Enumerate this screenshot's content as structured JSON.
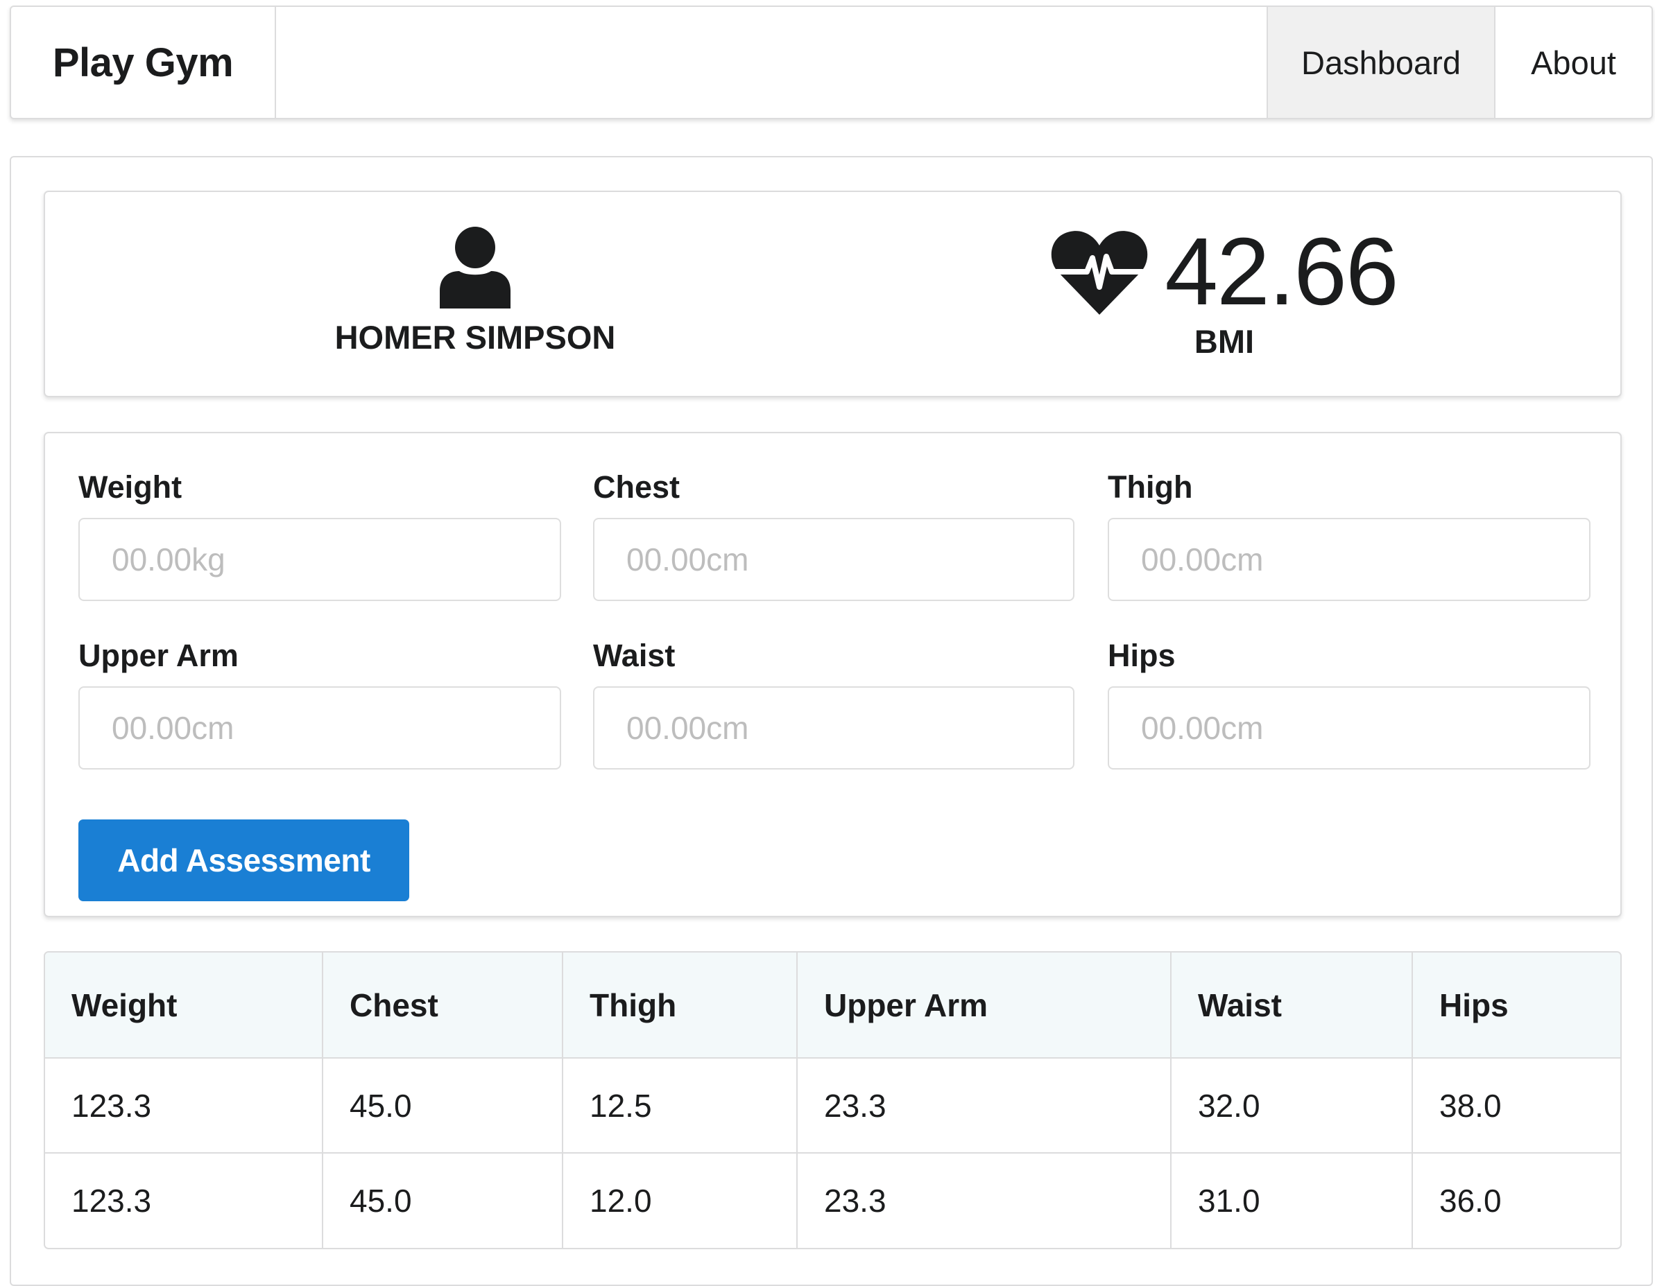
{
  "app": {
    "brand": "Play Gym",
    "nav": [
      {
        "label": "Dashboard",
        "active": true
      },
      {
        "label": "About",
        "active": false
      }
    ]
  },
  "member": {
    "name": "HOMER SIMPSON",
    "icon": "user-icon"
  },
  "bmi": {
    "value": "42.66",
    "label": "BMI",
    "icon": "heartbeat-icon"
  },
  "form": {
    "fields": [
      {
        "label": "Weight",
        "placeholder": "00.00kg"
      },
      {
        "label": "Chest",
        "placeholder": "00.00cm"
      },
      {
        "label": "Thigh",
        "placeholder": "00.00cm"
      },
      {
        "label": "Upper Arm",
        "placeholder": "00.00cm"
      },
      {
        "label": "Waist",
        "placeholder": "00.00cm"
      },
      {
        "label": "Hips",
        "placeholder": "00.00cm"
      }
    ],
    "submit_label": "Add Assessment",
    "submit_color": "#1a7fd4"
  },
  "assessments": {
    "columns": [
      "Weight",
      "Chest",
      "Thigh",
      "Upper Arm",
      "Waist",
      "Hips"
    ],
    "rows": [
      [
        "123.3",
        "45.0",
        "12.5",
        "23.3",
        "32.0",
        "38.0"
      ],
      [
        "123.3",
        "45.0",
        "12.0",
        "23.3",
        "31.0",
        "36.0"
      ]
    ]
  }
}
